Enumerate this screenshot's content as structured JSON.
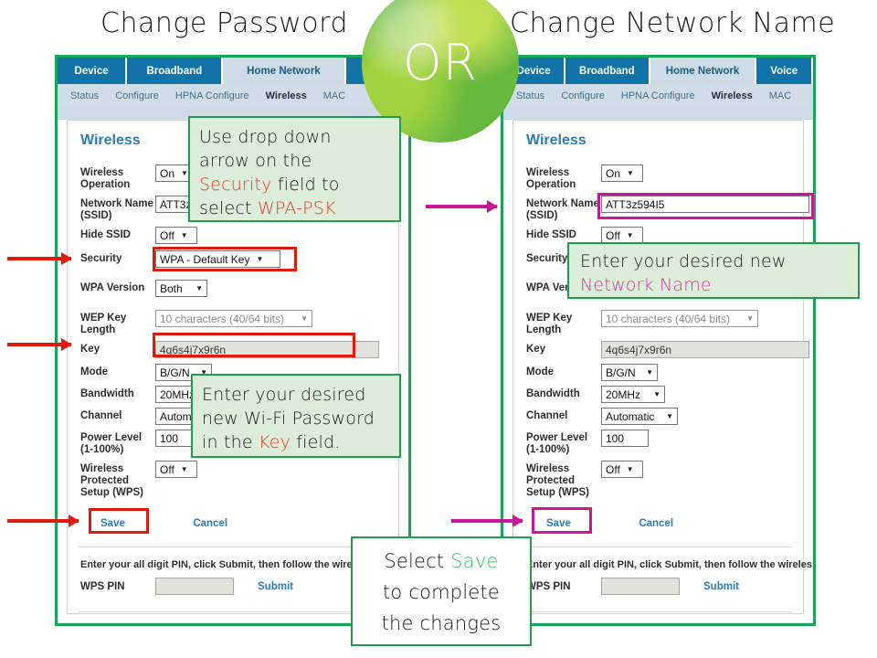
{
  "headings": {
    "left": "Change Password",
    "right": "Change Network Name"
  },
  "or_badge": {
    "label": "OR"
  },
  "router_ui": {
    "tabs": [
      {
        "label": "Device",
        "active": false
      },
      {
        "label": "Broadband",
        "active": false
      },
      {
        "label": "Home Network",
        "active": true
      },
      {
        "label": "Voice",
        "active": false
      }
    ],
    "subtabs": [
      {
        "label": "Status",
        "active": false
      },
      {
        "label": "Configure",
        "active": false
      },
      {
        "label": "HPNA Configure",
        "active": false
      },
      {
        "label": "Wireless",
        "active": true
      },
      {
        "label": "MAC",
        "active": false
      }
    ],
    "section_title": "Wireless",
    "fields": {
      "wireless_operation": {
        "label": "Wireless Operation",
        "value": "On"
      },
      "network_name": {
        "label": "Network Name (SSID)",
        "value": "ATT3z594I5"
      },
      "hide_ssid": {
        "label": "Hide SSID",
        "value": "Off"
      },
      "security": {
        "label": "Security",
        "value": "WPA - Default Key"
      },
      "wpa_version": {
        "label": "WPA Version",
        "value": "Both"
      },
      "wep_key_length": {
        "label": "WEP Key Length",
        "value": "10 characters (40/64 bits)"
      },
      "key": {
        "label": "Key",
        "value": "4q6s4j7x9r6n"
      },
      "mode": {
        "label": "Mode",
        "value": "B/G/N"
      },
      "bandwidth": {
        "label": "Bandwidth",
        "value": "20MHz"
      },
      "channel": {
        "label": "Channel",
        "value": "Automatic"
      },
      "power_level": {
        "label": "Power Level (1-100%)",
        "value": "100"
      },
      "wps": {
        "label": "Wireless Protected Setup (WPS)",
        "value": "Off"
      }
    },
    "buttons": {
      "save": "Save",
      "cancel": "Cancel",
      "submit": "Submit"
    },
    "wps_section": {
      "note": "Enter your all digit PIN, click Submit, then follow the wireless client instructions",
      "pin_label": "WPS PIN",
      "pin_value": "",
      "pin_placeholder": ""
    }
  },
  "callouts": {
    "security": {
      "line1": "Use drop down",
      "line2": "arrow on the",
      "line3_kw": "Security",
      "line3_rest": " field to",
      "line4_rest": "select ",
      "line4_kw": "WPA-PSK"
    },
    "key": {
      "line1": "Enter your desired",
      "line2": "new Wi-Fi Password",
      "line3_rest1": "in the ",
      "line3_kw": "Key",
      "line3_rest2": " field."
    },
    "ssid": {
      "line1": "Enter your desired new",
      "line2_kw": "Network Name"
    },
    "save": {
      "line1_rest": "Select ",
      "line1_kw": "Save",
      "line2": "to complete",
      "line3": "the changes"
    }
  },
  "colors": {
    "highlight_red": "#e01b0e",
    "highlight_magenta": "#c9169c",
    "panel_border_green": "#18a558",
    "callout_green": "#1e9e4a",
    "tab_blue": "#1273a8",
    "link_blue": "#2b7cb8"
  }
}
